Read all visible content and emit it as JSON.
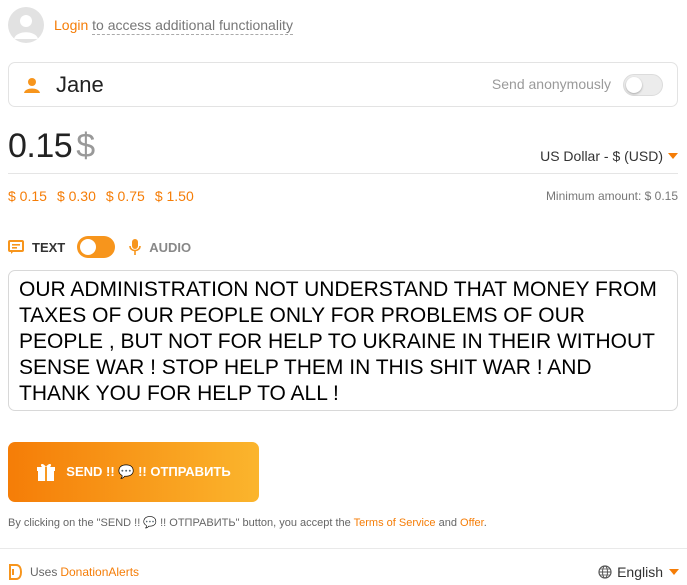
{
  "login": {
    "link": "Login",
    "rest": "to access additional functionality"
  },
  "sender": {
    "name": "Jane",
    "anonymous_label": "Send anonymously",
    "anonymous_on": false
  },
  "amount": {
    "value": "0.15",
    "symbol": "$",
    "currency": "US Dollar - $ (USD)",
    "presets": [
      "$ 0.15",
      "$ 0.30",
      "$ 0.75",
      "$ 1.50"
    ],
    "minimum": "Minimum amount: $ 0.15"
  },
  "mode": {
    "text_label": "TEXT",
    "audio_label": "AUDIO",
    "selected": "TEXT"
  },
  "message": {
    "text": "OUR ADMINISTRATION NOT UNDERSTAND THAT MONEY FROM TAXES OF OUR PEOPLE ONLY FOR PROBLEMS OF OUR PEOPLE , BUT NOT FOR HELP TO UKRAINE IN THEIR WITHOUT SENSE WAR ! STOP HELP THEM IN THIS SHIT WAR ! AND THANK YOU FOR HELP TO ALL !"
  },
  "send": {
    "label": "SEND !! 💬 !! ОТПРАВИТЬ"
  },
  "terms": {
    "prefix": "By clicking on the \"SEND !! 💬 !! ОТПРАВИТЬ\" button, you accept the",
    "tos": "Terms of Service",
    "and": "and",
    "offer": "Offer",
    "suffix": "."
  },
  "footer": {
    "uses": "Uses",
    "brand": "DonationAlerts",
    "language": "English"
  },
  "colors": {
    "accent": "#f57d07",
    "accent_light": "#fbb52d"
  },
  "icons": [
    "user-icon",
    "avatar-icon",
    "text-mode-icon",
    "microphone-icon",
    "gift-icon",
    "donationalerts-icon",
    "globe-icon"
  ]
}
